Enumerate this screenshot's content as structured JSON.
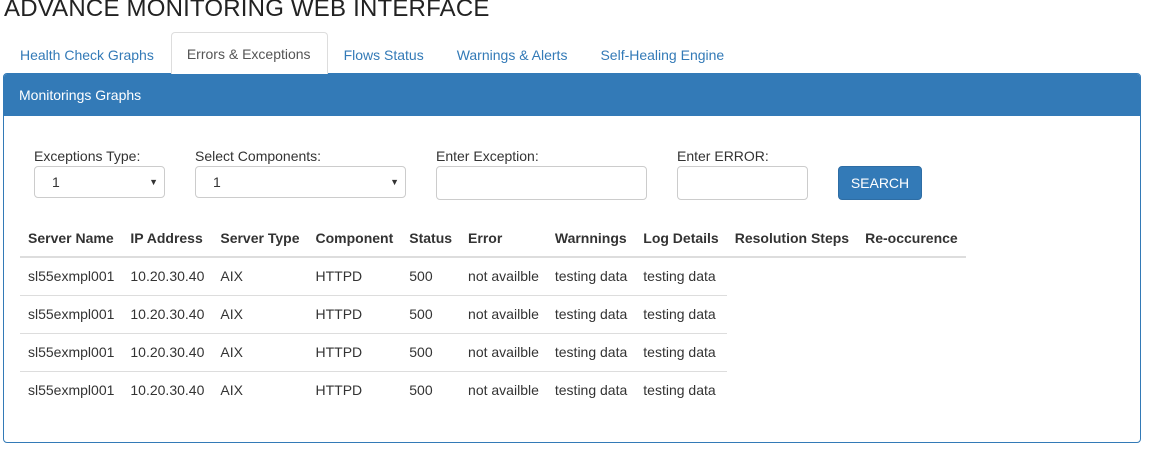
{
  "page": {
    "title": "ADVANCE MONITORING WEB INTERFACE"
  },
  "tabs": [
    {
      "label": "Health Check Graphs",
      "active": false
    },
    {
      "label": "Errors & Exceptions",
      "active": true
    },
    {
      "label": "Flows Status",
      "active": false
    },
    {
      "label": "Warnings & Alerts",
      "active": false
    },
    {
      "label": "Self-Healing Engine",
      "active": false
    }
  ],
  "panel": {
    "heading": "Monitorings Graphs"
  },
  "filters": {
    "exceptions_type": {
      "label": "Exceptions Type:",
      "value": "1"
    },
    "components": {
      "label": "Select Components:",
      "value": "1"
    },
    "exception": {
      "label": "Enter Exception:",
      "value": "",
      "placeholder": ""
    },
    "error": {
      "label": "Enter ERROR:",
      "value": "",
      "placeholder": ""
    },
    "search_label": "SEARCH"
  },
  "table": {
    "headers": [
      "Server Name",
      "IP Address",
      "Server Type",
      "Component",
      "Status",
      "Error",
      "Warnnings",
      "Log Details",
      "Resolution Steps",
      "Re-occurence"
    ],
    "rows": [
      [
        "sl55exmpl001",
        "10.20.30.40",
        "AIX",
        "HTTPD",
        "500",
        "not availble",
        "testing data",
        "testing data"
      ],
      [
        "sl55exmpl001",
        "10.20.30.40",
        "AIX",
        "HTTPD",
        "500",
        "not availble",
        "testing data",
        "testing data"
      ],
      [
        "sl55exmpl001",
        "10.20.30.40",
        "AIX",
        "HTTPD",
        "500",
        "not availble",
        "testing data",
        "testing data"
      ],
      [
        "sl55exmpl001",
        "10.20.30.40",
        "AIX",
        "HTTPD",
        "500",
        "not availble",
        "testing data",
        "testing data"
      ]
    ]
  },
  "colors": {
    "primary": "#337ab7",
    "link": "#337ab7",
    "border": "#dddddd"
  },
  "icons": {
    "select_caret": "caret-down-icon"
  }
}
